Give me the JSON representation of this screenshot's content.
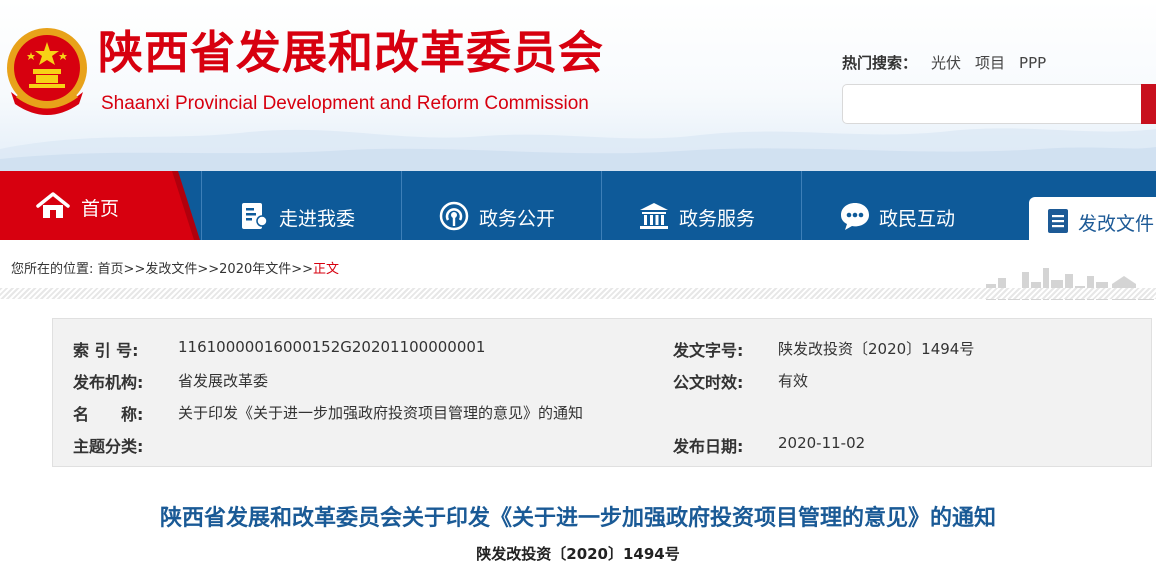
{
  "header": {
    "title": "陕西省发展和改革委员会",
    "subtitle": "Shaanxi Provincial Development and Reform Commission",
    "hot_search_label": "热门搜索：",
    "hot_search_links": [
      "光伏",
      "项目",
      "PPP"
    ],
    "search_value": ""
  },
  "nav": {
    "home": "首页",
    "items": [
      "走进我委",
      "政务公开",
      "政务服务",
      "政民互动"
    ],
    "active": "发改文件"
  },
  "breadcrumb": {
    "prefix": "您所在的位置:",
    "items": [
      "首页",
      "发改文件",
      "2020年文件"
    ],
    "separator": ">>",
    "current": "正文"
  },
  "info": {
    "index_label": "索 引 号:",
    "index_value": "11610000016000152G20201100000001",
    "doc_no_label": "发文字号:",
    "doc_no_value": "陕发改投资〔2020〕1494号",
    "issuer_label": "发布机构:",
    "issuer_value": "省发展改革委",
    "validity_label": "公文时效:",
    "validity_value": "有效",
    "name_label": "名　　称:",
    "name_value": "关于印发《关于进一步加强政府投资项目管理的意见》的通知",
    "topic_label": "主题分类:",
    "topic_value": "",
    "date_label": "发布日期:",
    "date_value": "2020-11-02"
  },
  "document": {
    "title": "陕西省发展和改革委员会关于印发《关于进一步加强政府投资项目管理的意见》的通知",
    "number": "陕发改投资〔2020〕1494号"
  },
  "colors": {
    "brand_red": "#d7000f",
    "nav_blue": "#0e5a99",
    "title_blue": "#1a5a96"
  }
}
